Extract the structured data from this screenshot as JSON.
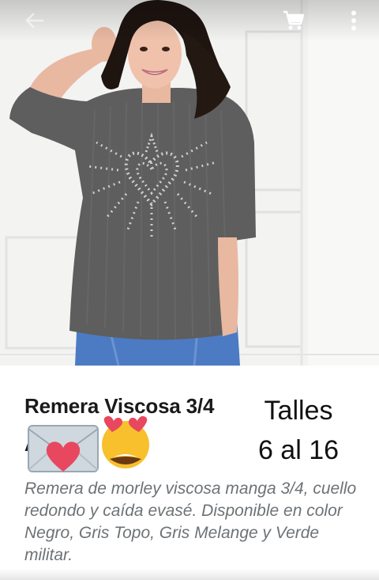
{
  "appbar": {
    "back_icon": "arrow-left-icon",
    "cart_icon": "shopping-cart-icon",
    "menu_icon": "more-vertical-icon"
  },
  "product": {
    "title": "Remera Viscosa 3/4",
    "subtitle_partial": "A           C",
    "talles_label": "Talles",
    "talles_range": "6 al 16",
    "description": "Remera de morley viscosa manga 3/4, cuello redondo y caída evasé. Disponible en color Negro, Gris Topo, Gris Melange y Verde militar.",
    "emojis": [
      "love-letter-emoji",
      "heart-eyes-emoji"
    ]
  },
  "colors": {
    "title_text": "#1a1a1a",
    "description_text": "#6d7276",
    "shirt_gray": "#5e5e5e",
    "jeans_blue": "#4c7bc3"
  }
}
